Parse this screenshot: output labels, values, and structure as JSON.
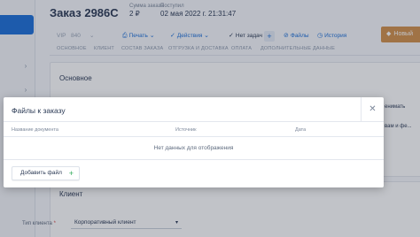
{
  "order": {
    "title": "Заказ 2986С",
    "sum_label": "Сумма заказа",
    "sum_value": "2 ₽",
    "received_label": "Поступил",
    "received_value": "02 мая 2022 г. 21:31:47"
  },
  "toolbar": {
    "vip": "VIP",
    "code": "840",
    "print_label": "Печать",
    "actions_label": "Действия",
    "no_tasks_label": "Нет задач",
    "files_label": "Файлы",
    "history_label": "История",
    "new_label": "Новый"
  },
  "tabs": [
    "ОСНОВНОЕ",
    "КЛИЕНТ",
    "СОСТАВ ЗАКАЗА",
    "ОТГРУЗКА И ДОСТАВКА",
    "ОПЛАТА",
    "ДОПОЛНИТЕЛЬНЫЕ ДАННЫЕ"
  ],
  "sections": {
    "main_title": "Основное",
    "client_title": "Клиент",
    "right_snippet_1": "енимать",
    "right_snippet_2": "вам и фе..."
  },
  "client": {
    "type_label": "Тип клиента",
    "required_mark": "*",
    "type_value": "Корпоративный клиент"
  },
  "modal": {
    "title": "Файлы к заказу",
    "close_glyph": "✕",
    "columns": [
      "Название документа",
      "Источник",
      "Дата"
    ],
    "empty_text": "Нет данных для отображения",
    "add_button": "Добавить файл",
    "add_glyph": "+"
  },
  "icons": [
    "chevron-right-icon",
    "printer-icon",
    "chevron-down-icon",
    "check-icon",
    "plus-icon",
    "link-icon",
    "history-icon",
    "tag-icon",
    "close-icon"
  ],
  "colors": {
    "accent": "#1c6fd8",
    "new_badge": "#d2904c",
    "add_plus": "#2eaa5a"
  }
}
